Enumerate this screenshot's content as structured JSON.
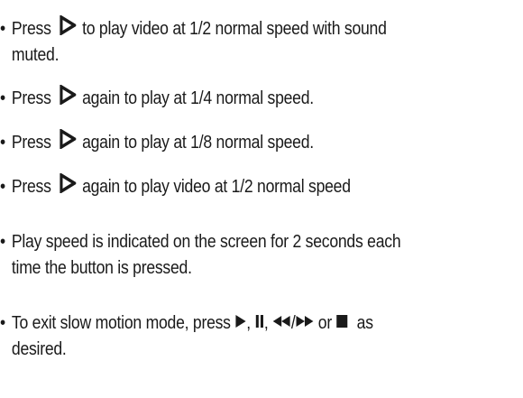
{
  "bullet": "•",
  "items": [
    {
      "lead": "Press",
      "rest_line1": "to play video at 1/2 normal speed with sound",
      "line2": "muted."
    },
    {
      "lead": "Press",
      "rest_line1": "again to play at 1/4 normal speed."
    },
    {
      "lead": "Press",
      "rest_line1": "again to play at 1/8 normal speed."
    },
    {
      "lead": "Press",
      "rest_line1": "again to play video at 1/2 normal speed"
    },
    {
      "line1": "Play speed is indicated on the screen for 2 seconds each",
      "line2": "time the button is pressed."
    },
    {
      "line1_prefix": "To exit slow motion mode, press",
      "sep1": ",",
      "sep2": ",",
      "slash": "/",
      "or_word": "or",
      "suffix": "as",
      "line2": "desired."
    }
  ],
  "icons": {
    "frame_advance": "frame-advance-icon",
    "play": "play-icon",
    "pause": "pause-icon",
    "rewind": "rewind-icon",
    "fast_forward": "fast-forward-icon",
    "stop": "stop-icon"
  }
}
